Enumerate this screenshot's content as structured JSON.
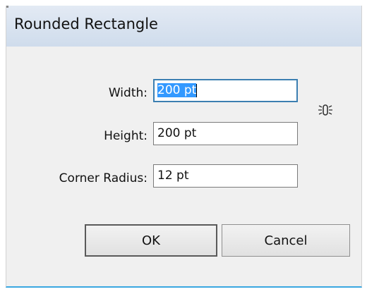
{
  "dialog": {
    "title": "Rounded Rectangle"
  },
  "fields": {
    "width": {
      "label": "Width:",
      "value": "200 pt"
    },
    "height": {
      "label": "Height:",
      "value": "200 pt"
    },
    "corner_radius": {
      "label": "Corner Radius:",
      "value": "12 pt"
    }
  },
  "icons": {
    "constrain": "link-proportions-icon"
  },
  "buttons": {
    "ok": "OK",
    "cancel": "Cancel"
  },
  "colors": {
    "selection": "#3399ff",
    "focus_border": "#3c7fb1",
    "accent_bottom": "#3aa7e0"
  }
}
